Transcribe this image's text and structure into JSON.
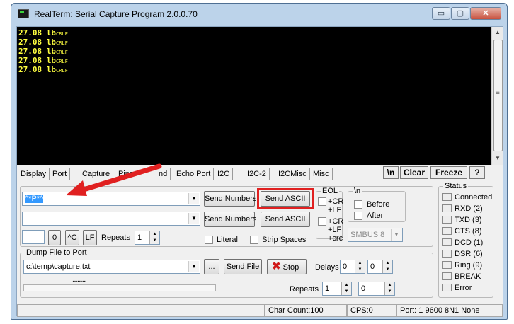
{
  "window": {
    "title": "RealTerm: Serial Capture Program 2.0.0.70",
    "min_label": "▭",
    "max_label": "▢",
    "close_label": "✕"
  },
  "terminal": {
    "lines": [
      {
        "text": "27.08 lb",
        "suffix": "CRLF"
      },
      {
        "text": "27.08 lb",
        "suffix": "CRLF"
      },
      {
        "text": "27.08 lb",
        "suffix": "CRLF"
      },
      {
        "text": "27.08 lb",
        "suffix": "CRLF"
      },
      {
        "text": "27.08 lb",
        "suffix": "CRLF"
      }
    ]
  },
  "tabs": {
    "items": [
      "Display",
      "Port",
      "Capture",
      "Pins",
      "Send",
      "Echo Port",
      "I2C",
      "I2C-2",
      "I2CMisc",
      "Misc"
    ],
    "pins_visible": "Pins",
    "send_visible": "nd",
    "newline_button": "\\n",
    "clear_button": "Clear",
    "freeze_button": "Freeze",
    "help_button": "?"
  },
  "send": {
    "input1_value": "^*P*^",
    "input2_value": "",
    "send_numbers_label": "Send Numbers",
    "send_ascii_label": "Send ASCII",
    "number_field_value": "",
    "zero_button": "0",
    "ctrl_c_button": "^C",
    "lf_button": "LF",
    "repeats_label": "Repeats",
    "repeats_value": "1",
    "literal_label": "Literal",
    "strip_spaces_label": "Strip Spaces"
  },
  "eol": {
    "title": "EOL",
    "row1": [
      "+CR",
      "+LF"
    ],
    "row2": [
      "+CR",
      "+LF",
      "+crc"
    ]
  },
  "newline_group": {
    "title": "\\n",
    "before_label": "Before",
    "after_label": "After",
    "smbus_value": "SMBUS 8"
  },
  "dump": {
    "title": "Dump File to Port",
    "file_value": "c:\\temp\\capture.txt",
    "browse_button": "...",
    "send_file_button": "Send File",
    "stop_button": "Stop",
    "delays_label": "Delays",
    "delay1_value": "0",
    "delay2_value": "0",
    "repeats_label": "Repeats",
    "repeats1_value": "1",
    "repeats2_value": "0",
    "progress_text": "..........."
  },
  "status": {
    "title": "Status",
    "items": [
      "Connected",
      "RXD (2)",
      "TXD (3)",
      "CTS (8)",
      "DCD (1)",
      "DSR (6)",
      "Ring (9)",
      "BREAK",
      "Error"
    ]
  },
  "statusbar": {
    "char_count": "Char Count:100",
    "cps": "CPS:0",
    "port": "Port: 1 9600 8N1 None"
  },
  "colors": {
    "terminal_bg": "#000000",
    "terminal_text": "#ffff40",
    "highlight": "#e02020",
    "selection": "#3399ff"
  },
  "icons": {
    "stop": "red-x-icon",
    "arrow": "red-arrow-icon"
  }
}
